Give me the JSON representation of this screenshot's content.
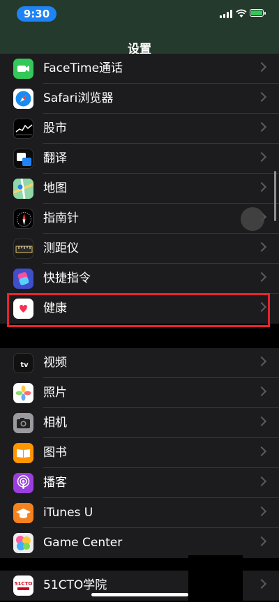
{
  "status_bar": {
    "time": "9:30",
    "signal_icon": "cellular-signal-icon",
    "wifi_icon": "wifi-icon",
    "battery_icon": "battery-charging-icon",
    "battery_color": "#34c759"
  },
  "nav": {
    "title": "设置"
  },
  "groups": [
    {
      "items": [
        {
          "label": "FaceTime通话",
          "icon": "facetime-icon"
        },
        {
          "label": "Safari浏览器",
          "icon": "safari-icon"
        },
        {
          "label": "股市",
          "icon": "stocks-icon"
        },
        {
          "label": "翻译",
          "icon": "translate-icon"
        },
        {
          "label": "地图",
          "icon": "maps-icon"
        },
        {
          "label": "指南针",
          "icon": "compass-icon"
        },
        {
          "label": "测距仪",
          "icon": "measure-icon"
        },
        {
          "label": "快捷指令",
          "icon": "shortcuts-icon"
        },
        {
          "label": "健康",
          "icon": "health-icon"
        }
      ]
    },
    {
      "items": [
        {
          "label": "视频",
          "icon": "apple-tv-icon",
          "icon_text": "tv"
        },
        {
          "label": "照片",
          "icon": "photos-icon"
        },
        {
          "label": "相机",
          "icon": "camera-icon"
        },
        {
          "label": "图书",
          "icon": "books-icon"
        },
        {
          "label": "播客",
          "icon": "podcasts-icon"
        },
        {
          "label": "iTunes U",
          "icon": "itunes-u-icon"
        },
        {
          "label": "Game Center",
          "icon": "game-center-icon"
        }
      ]
    },
    {
      "items": [
        {
          "label": "51CTO学院",
          "icon": "51cto-icon",
          "icon_text": "51CTO"
        }
      ]
    }
  ],
  "highlight_color": "#e8232e"
}
